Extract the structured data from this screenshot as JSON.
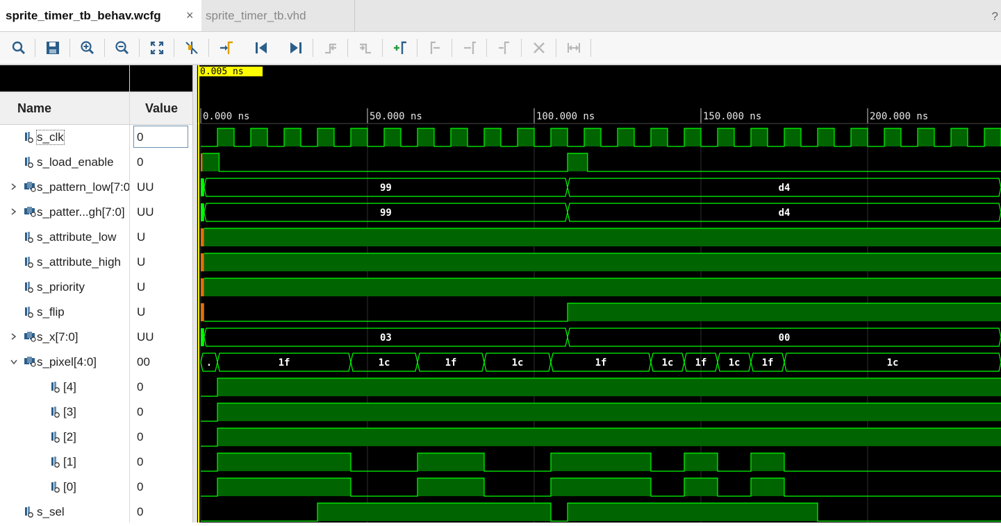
{
  "tabs": {
    "active": "sprite_timer_tb_behav.wcfg",
    "inactive": "sprite_timer_tb.vhd",
    "close_glyph": "×",
    "help_glyph": "?"
  },
  "toolbar": {
    "icons": [
      "search-icon",
      "save-icon",
      "zoom-in-icon",
      "zoom-out-icon",
      "zoom-fit-icon",
      "cursor-snap-icon",
      "add-marker-icon",
      "go-to-start-icon",
      "go-to-end-icon",
      "previous-transition-icon",
      "next-transition-icon",
      "add-marker-plus-icon",
      "previous-marker-icon",
      "next-marker-icon",
      "swap-cursors-icon",
      "delete-marker-icon",
      "marker-bracket-icon"
    ]
  },
  "columns": {
    "name": "Name",
    "value": "Value"
  },
  "cursor_time": "0.005 ns",
  "time_axis": {
    "labels": [
      "0.000 ns",
      "50.000 ns",
      "100.000 ns",
      "150.000 ns",
      "200.000 ns"
    ],
    "ticks_ns": [
      0,
      50,
      100,
      150,
      200
    ],
    "range_ns": [
      0,
      240
    ]
  },
  "colors": {
    "wave": "#00ff00",
    "fill": "#006400",
    "grid": "#2f2f2f",
    "cursor": "#ffff00",
    "cursor_label_bg": "#ffff00"
  },
  "signals": [
    {
      "name": "s_clk",
      "value": "0",
      "type": "bit",
      "indent": 0,
      "expand": "",
      "selected": true
    },
    {
      "name": "s_load_enable",
      "value": "0",
      "type": "bit",
      "indent": 0,
      "expand": ""
    },
    {
      "name": "s_pattern_low[7:0]",
      "value": "UU",
      "type": "bus",
      "indent": 0,
      "expand": ">"
    },
    {
      "name": "s_patter...gh[7:0]",
      "value": "UU",
      "type": "bus",
      "indent": 0,
      "expand": ">"
    },
    {
      "name": "s_attribute_low",
      "value": "U",
      "type": "bit",
      "indent": 0,
      "expand": ""
    },
    {
      "name": "s_attribute_high",
      "value": "U",
      "type": "bit",
      "indent": 0,
      "expand": ""
    },
    {
      "name": "s_priority",
      "value": "U",
      "type": "bit",
      "indent": 0,
      "expand": ""
    },
    {
      "name": "s_flip",
      "value": "U",
      "type": "bit",
      "indent": 0,
      "expand": ""
    },
    {
      "name": "s_x[7:0]",
      "value": "UU",
      "type": "bus",
      "indent": 0,
      "expand": ">"
    },
    {
      "name": "s_pixel[4:0]",
      "value": "00",
      "type": "bus",
      "indent": 0,
      "expand": "v"
    },
    {
      "name": "[4]",
      "value": "0",
      "type": "bit",
      "indent": 1,
      "expand": ""
    },
    {
      "name": "[3]",
      "value": "0",
      "type": "bit",
      "indent": 1,
      "expand": ""
    },
    {
      "name": "[2]",
      "value": "0",
      "type": "bit",
      "indent": 1,
      "expand": ""
    },
    {
      "name": "[1]",
      "value": "0",
      "type": "bit",
      "indent": 1,
      "expand": ""
    },
    {
      "name": "[0]",
      "value": "0",
      "type": "bit",
      "indent": 1,
      "expand": ""
    },
    {
      "name": "s_sel",
      "value": "0",
      "type": "bit",
      "indent": 0,
      "expand": ""
    }
  ],
  "waves": [
    {
      "kind": "clock",
      "period_ns": 10,
      "first_rise_ns": 5,
      "high_ns": 5
    },
    {
      "kind": "bit",
      "segments": [
        [
          0,
          0.5,
          "U"
        ],
        [
          0.5,
          5.5,
          "1"
        ],
        [
          5.5,
          110,
          "0"
        ],
        [
          110,
          116,
          "1"
        ],
        [
          116,
          240,
          "0"
        ]
      ]
    },
    {
      "kind": "bus",
      "segments": [
        [
          0,
          1,
          "U",
          ""
        ],
        [
          1,
          110,
          "v",
          "99"
        ],
        [
          110,
          240,
          "v",
          "d4"
        ]
      ]
    },
    {
      "kind": "bus",
      "segments": [
        [
          0,
          1,
          "U",
          ""
        ],
        [
          1,
          110,
          "v",
          "99"
        ],
        [
          110,
          240,
          "v",
          "d4"
        ]
      ]
    },
    {
      "kind": "bit",
      "segments": [
        [
          0,
          1,
          "U"
        ],
        [
          1,
          240,
          "1"
        ]
      ]
    },
    {
      "kind": "bit",
      "segments": [
        [
          0,
          1,
          "U"
        ],
        [
          1,
          240,
          "1"
        ]
      ]
    },
    {
      "kind": "bit",
      "segments": [
        [
          0,
          1,
          "U"
        ],
        [
          1,
          240,
          "1"
        ]
      ]
    },
    {
      "kind": "bit",
      "segments": [
        [
          0,
          1,
          "U"
        ],
        [
          1,
          110,
          "0"
        ],
        [
          110,
          240,
          "1"
        ]
      ]
    },
    {
      "kind": "bus",
      "segments": [
        [
          0,
          1,
          "U",
          ""
        ],
        [
          1,
          110,
          "v",
          "03"
        ],
        [
          110,
          240,
          "v",
          "00"
        ]
      ]
    },
    {
      "kind": "bus",
      "segments": [
        [
          0,
          5,
          "v",
          "."
        ],
        [
          5,
          45,
          "v",
          "1f"
        ],
        [
          45,
          65,
          "v",
          "1c"
        ],
        [
          65,
          85,
          "v",
          "1f"
        ],
        [
          85,
          105,
          "v",
          "1c"
        ],
        [
          105,
          135,
          "v",
          "1f"
        ],
        [
          135,
          145,
          "v",
          "1c"
        ],
        [
          145,
          155,
          "v",
          "1f"
        ],
        [
          155,
          165,
          "v",
          "1c"
        ],
        [
          165,
          175,
          "v",
          "1f"
        ],
        [
          175,
          240,
          "v",
          "1c"
        ]
      ]
    },
    {
      "kind": "bit",
      "segments": [
        [
          0,
          5,
          "0"
        ],
        [
          5,
          240,
          "1"
        ]
      ]
    },
    {
      "kind": "bit",
      "segments": [
        [
          0,
          5,
          "0"
        ],
        [
          5,
          240,
          "1"
        ]
      ]
    },
    {
      "kind": "bit",
      "segments": [
        [
          0,
          5,
          "0"
        ],
        [
          5,
          240,
          "1"
        ]
      ]
    },
    {
      "kind": "bit",
      "segments": [
        [
          0,
          5,
          "0"
        ],
        [
          5,
          45,
          "1"
        ],
        [
          45,
          65,
          "0"
        ],
        [
          65,
          85,
          "1"
        ],
        [
          85,
          105,
          "0"
        ],
        [
          105,
          135,
          "1"
        ],
        [
          135,
          145,
          "0"
        ],
        [
          145,
          155,
          "1"
        ],
        [
          155,
          165,
          "0"
        ],
        [
          165,
          175,
          "1"
        ],
        [
          175,
          240,
          "0"
        ]
      ]
    },
    {
      "kind": "bit",
      "segments": [
        [
          0,
          5,
          "0"
        ],
        [
          5,
          45,
          "1"
        ],
        [
          45,
          65,
          "0"
        ],
        [
          65,
          85,
          "1"
        ],
        [
          85,
          105,
          "0"
        ],
        [
          105,
          135,
          "1"
        ],
        [
          135,
          145,
          "0"
        ],
        [
          145,
          155,
          "1"
        ],
        [
          155,
          165,
          "0"
        ],
        [
          165,
          175,
          "1"
        ],
        [
          175,
          240,
          "0"
        ]
      ]
    },
    {
      "kind": "bit",
      "segments": [
        [
          0,
          35,
          "0"
        ],
        [
          35,
          105,
          "1"
        ],
        [
          105,
          110,
          "0"
        ],
        [
          110,
          185,
          "1"
        ],
        [
          185,
          240,
          "0"
        ]
      ]
    }
  ]
}
